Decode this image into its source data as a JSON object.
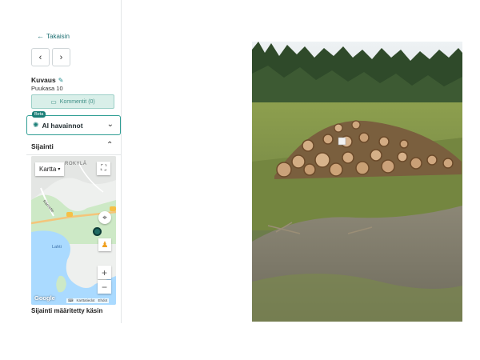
{
  "nav": {
    "back_label": "Takaisin",
    "prev_icon": "chevron-left-icon",
    "next_icon": "chevron-right-icon"
  },
  "description": {
    "title": "Kuvaus",
    "text": "Puukasa 10"
  },
  "comments": {
    "label": "Kommentit (0)"
  },
  "ai": {
    "badge": "Beta",
    "label": "AI havainnot"
  },
  "location": {
    "title": "Sijainti",
    "note": "Sijainti määritetty käsin"
  },
  "map": {
    "type_label": "Kartta",
    "place_label": "ROKYLÄ",
    "lake_label": "Lahti",
    "road_label": "Rämetie",
    "google_label": "Google",
    "footer_shortcuts": "Pikanäppäimet",
    "footer_data": "Karttatiedot",
    "footer_terms": "Ehdot"
  },
  "colors": {
    "accent": "#1b7f78",
    "comments_bg": "#d9efe9",
    "map_water": "#aadaff",
    "map_forest": "#cde9c6"
  }
}
